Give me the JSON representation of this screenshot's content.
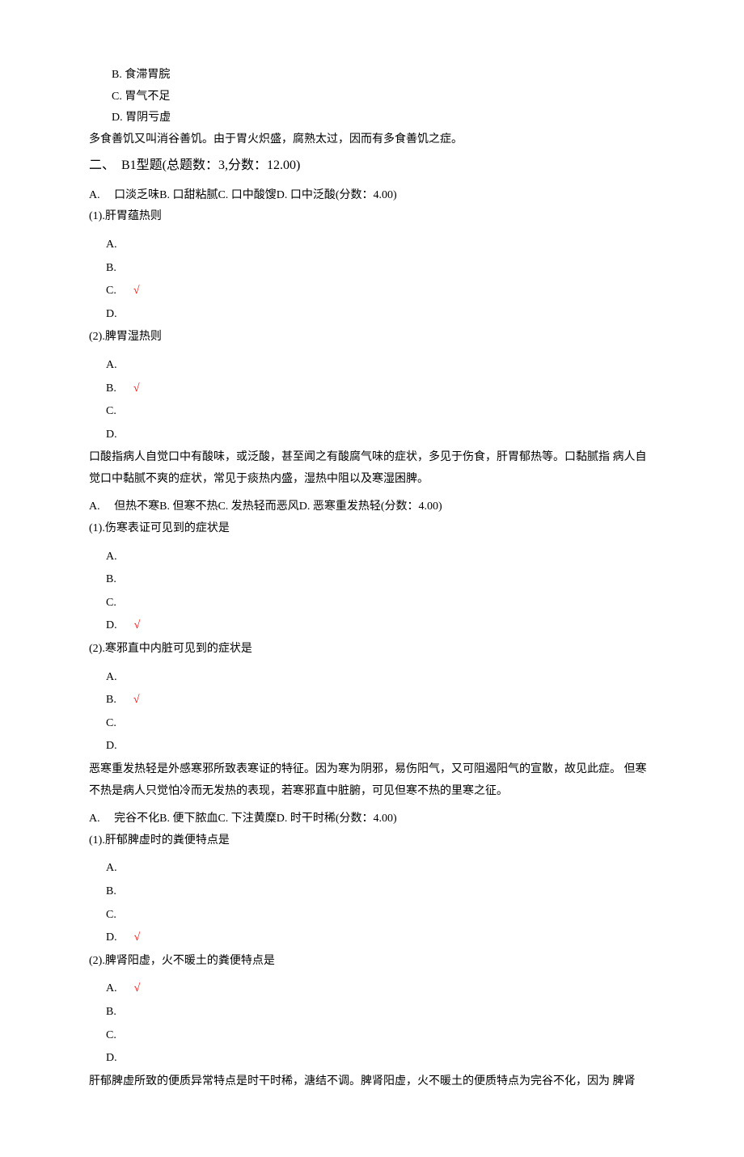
{
  "top_options": [
    {
      "letter": "B",
      "text": "食滞胃脘"
    },
    {
      "letter": "C",
      "text": "胃气不足"
    },
    {
      "letter": "D",
      "text": "胃阴亏虚"
    }
  ],
  "top_explanation": "多食善饥又叫消谷善饥。由于胃火炽盛，腐熟太过，因而有多食善饥之症。",
  "section_header": "二、　B1型题(总题数：3,分数：12.00)",
  "groups": [
    {
      "stem": "A. 　口淡乏味B. 口甜粘腻C. 口中酸馊D. 口中泛酸(分数：4.00)",
      "subs": [
        {
          "prompt": "(1).肝胃蕴热则",
          "options": [
            {
              "label": "A.",
              "correct": false
            },
            {
              "label": "B.",
              "correct": false
            },
            {
              "label": "C.",
              "correct": true
            },
            {
              "label": "D.",
              "correct": false
            }
          ]
        },
        {
          "prompt": "(2).脾胃湿热则",
          "options": [
            {
              "label": "A.",
              "correct": false
            },
            {
              "label": "B.",
              "correct": true
            },
            {
              "label": "C.",
              "correct": false
            },
            {
              "label": "D.",
              "correct": false
            }
          ]
        }
      ],
      "explanation": "口酸指病人自觉口中有酸味，或泛酸，甚至闻之有酸腐气味的症状，多见于伤食，肝胃郁热等。口黏腻指 病人自觉口中黏腻不爽的症状，常见于痰热内盛，湿热中阻以及寒湿困脾。"
    },
    {
      "stem": "A. 　但热不寒B. 但寒不热C. 发热轻而恶风D. 恶寒重发热轻(分数：4.00)",
      "subs": [
        {
          "prompt": "(1).伤寒表证可见到的症状是",
          "options": [
            {
              "label": "A.",
              "correct": false
            },
            {
              "label": "B.",
              "correct": false
            },
            {
              "label": "C.",
              "correct": false
            },
            {
              "label": "D.",
              "correct": true
            }
          ]
        },
        {
          "prompt": "(2).寒邪直中内脏可见到的症状是",
          "options": [
            {
              "label": "A.",
              "correct": false
            },
            {
              "label": "B.",
              "correct": true
            },
            {
              "label": "C.",
              "correct": false
            },
            {
              "label": "D.",
              "correct": false
            }
          ]
        }
      ],
      "explanation": "恶寒重发热轻是外感寒邪所致表寒证的特征。因为寒为阴邪，易伤阳气，又可阻遏阳气的宣散，故见此症。 但寒不热是病人只觉怕冷而无发热的表现，若寒邪直中脏腑，可见但寒不热的里寒之征。"
    },
    {
      "stem": "A. 　完谷不化B. 便下脓血C. 下注黄糜D. 时干时稀(分数：4.00)",
      "subs": [
        {
          "prompt": "(1).肝郁脾虚时的粪便特点是",
          "options": [
            {
              "label": "A.",
              "correct": false
            },
            {
              "label": "B.",
              "correct": false
            },
            {
              "label": "C.",
              "correct": false
            },
            {
              "label": "D.",
              "correct": true
            }
          ]
        },
        {
          "prompt": "(2).脾肾阳虚，火不暖土的粪便特点是",
          "options": [
            {
              "label": "A.",
              "correct": true
            },
            {
              "label": "B.",
              "correct": false
            },
            {
              "label": "C.",
              "correct": false
            },
            {
              "label": "D.",
              "correct": false
            }
          ]
        }
      ],
      "explanation": "肝郁脾虚所致的便质异常特点是时干时稀，溏结不调。脾肾阳虚，火不暖土的便质特点为完谷不化，因为 脾肾"
    }
  ],
  "check_mark": "√"
}
